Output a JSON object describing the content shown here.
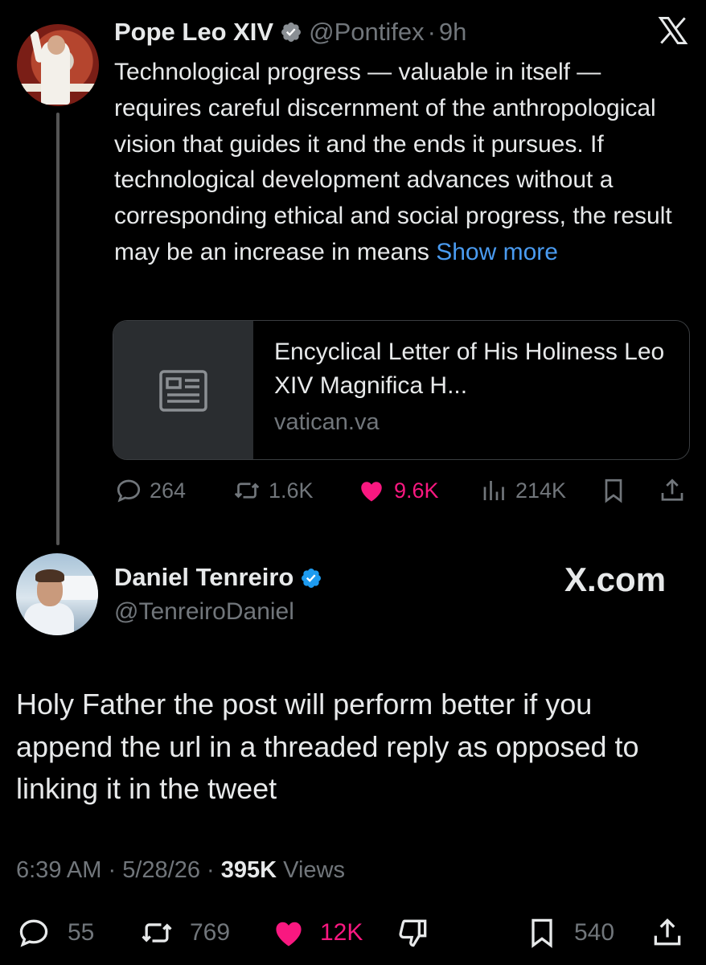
{
  "parent_tweet": {
    "author_name": "Pope Leo XIV",
    "handle": "@Pontifex",
    "separator": "·",
    "time": "9h",
    "text": "Technological progress — valuable in itself — requires careful discernment of the anthropological vision that guides it and the ends it pursues. If technological development advances without a corresponding ethical and social progress, the result may be an increase in means ",
    "show_more_label": "Show more",
    "link_card": {
      "title": "Encyclical Letter of His Holiness Leo XIV Magnifica H...",
      "domain": "vatican.va",
      "thumb_icon": "article-icon"
    },
    "actions": {
      "replies": "264",
      "reposts": "1.6K",
      "likes": "9.6K",
      "views": "214K"
    }
  },
  "reply_tweet": {
    "author_name": "Daniel Tenreiro",
    "handle": "@TenreiroDaniel",
    "watermark": "X.com",
    "text": "Holy Father the post will perform better if you append the url in a threaded reply as opposed to linking it in the tweet",
    "meta": {
      "time": "6:39 AM",
      "separator": "·",
      "date": "5/28/26",
      "views_count": "395K",
      "views_label": "Views"
    },
    "actions": {
      "replies": "55",
      "reposts": "769",
      "likes": "12K",
      "bookmarks": "540"
    }
  },
  "colors": {
    "background": "#000000",
    "text": "#e7e9ea",
    "secondary": "#71767b",
    "link": "#4a9bf0",
    "verified": "#1d9bf0",
    "like": "#f91880"
  }
}
